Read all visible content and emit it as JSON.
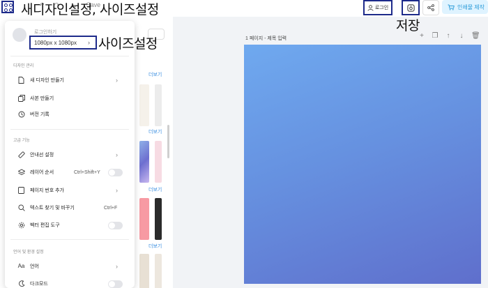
{
  "topbar": {
    "undo_items": [
      "↶",
      "↷",
      "☁",
      "Save"
    ],
    "login_label": "로그인",
    "print_label": "인쇄물 제작"
  },
  "annotations": {
    "top": "새디자인설정, 사이즈설정",
    "size": "사이즈설정",
    "save": "저장"
  },
  "menu": {
    "profile_name": "로그인하기",
    "size_value": "1080px x 1080px",
    "sections": {
      "design": "디자인 관리",
      "advanced": "고급 기능",
      "language": "언어 및 환경 설정"
    },
    "items": {
      "new_design": "새 디자인 만들기",
      "copy": "사본 만들기",
      "history": "버전 기록",
      "guides": "안내선 설정",
      "layers": "레이어 순서",
      "layers_shortcut": "Ctrl+Shift+Y",
      "page_number": "페이지 번호 추가",
      "find_replace": "텍스트 찾기 및 바꾸기",
      "find_shortcut": "Ctrl+F",
      "vector_tool": "벡터 편집 도구",
      "language": "언어",
      "dark_mode": "다크모드"
    },
    "icons": {
      "language": "Aa"
    }
  },
  "panel": {
    "more_label": "더보기"
  },
  "canvas": {
    "page_label": "1 페이지 - 제목 입력",
    "colors": {
      "gradient_start": "#6fa9ef",
      "gradient_end": "#5f6fcc"
    }
  },
  "colors": {
    "annotation_border": "#1d2a8a",
    "accent": "#2a9bd8"
  }
}
